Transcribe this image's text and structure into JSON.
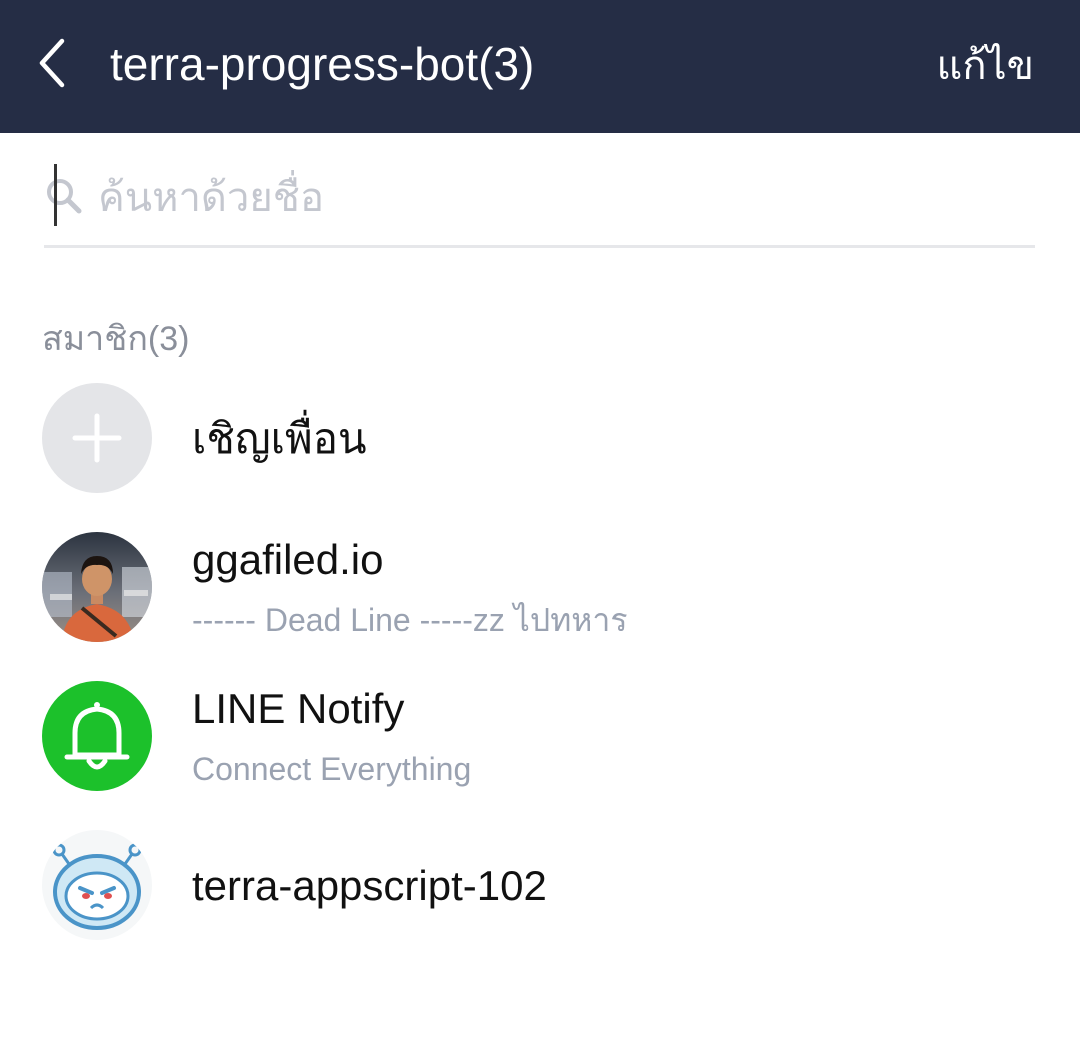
{
  "header": {
    "title": "terra-progress-bot(3)",
    "edit_label": "แก้ไข",
    "back_icon": "chevron-left-icon",
    "background": "#252d45"
  },
  "search": {
    "placeholder": "ค้นหาด้วยชื่อ",
    "value": "",
    "icon": "search-icon"
  },
  "members": {
    "section_label": "สมาชิก(3)",
    "invite": {
      "label": "เชิญเพื่อน",
      "icon": "plus-icon"
    },
    "items": [
      {
        "name": "ggafiled.io",
        "status": "------ Dead Line -----zz ไปทหาร",
        "avatar": "profile-photo"
      },
      {
        "name": "LINE Notify",
        "status": "Connect Everything",
        "avatar": "bell-icon",
        "avatar_color": "#1cc12b"
      },
      {
        "name": "terra-appscript-102",
        "status": "",
        "avatar": "robot-icon"
      }
    ]
  }
}
